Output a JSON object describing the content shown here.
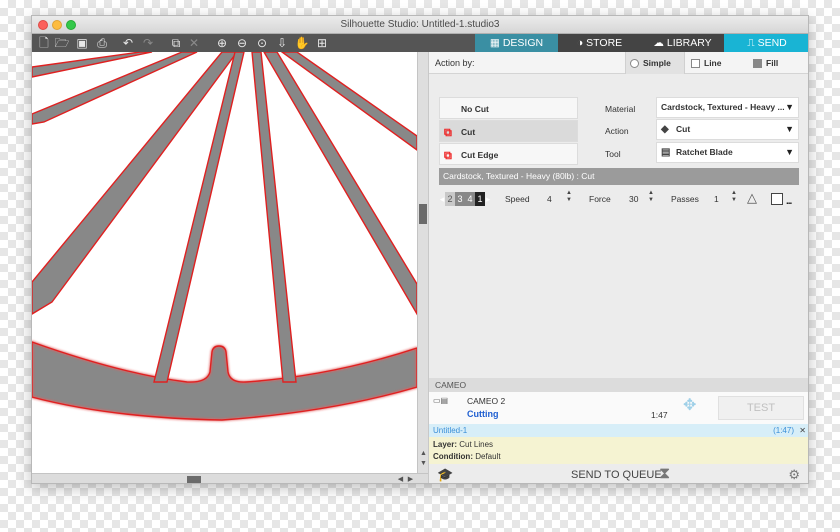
{
  "window": {
    "title": "Silhouette Studio: Untitled-1.studio3"
  },
  "toolbar": {
    "icons": [
      "new-icon",
      "open-icon",
      "save-icon",
      "print-icon",
      "undo-icon",
      "redo-icon",
      "group-icon",
      "ungroup-icon",
      "zoom-in-icon",
      "zoom-out-icon",
      "zoom-fit-icon",
      "pan-down-icon",
      "hand-icon",
      "add-page-icon"
    ]
  },
  "tabs": {
    "design": "DESIGN",
    "store": "STORE",
    "library": "LIBRARY",
    "send": "SEND"
  },
  "panel": {
    "action_by_label": "Action by:",
    "mode_simple": "Simple",
    "mode_line": "Line",
    "mode_fill": "Fill",
    "cut_options": [
      "No Cut",
      "Cut",
      "Cut Edge"
    ],
    "material_label": "Material",
    "material_value": "Cardstock, Textured - Heavy ...",
    "action_label": "Action",
    "action_value": "Cut",
    "tool_label": "Tool",
    "tool_value": "Ratchet Blade",
    "material_bar": "Cardstock, Textured - Heavy (80lb) : Cut",
    "sequence": [
      "2",
      "3",
      "4",
      "1"
    ],
    "speed_label": "Speed",
    "speed_value": "4",
    "force_label": "Force",
    "force_value": "30",
    "passes_label": "Passes",
    "passes_value": "1",
    "more": "..."
  },
  "device": {
    "section": "CAMEO",
    "name": "CAMEO 2",
    "status": "Cutting",
    "time": "1:47",
    "test_label": "TEST"
  },
  "job": {
    "name": "Untitled-1",
    "time": "(1:47)",
    "close": "✕",
    "layer_label": "Layer:",
    "layer_value": "Cut Lines",
    "condition_label": "Condition:",
    "condition_value": "Default"
  },
  "bottom": {
    "send_to_queue": "SEND TO QUEUE"
  },
  "colors": {
    "send_tab": "#19b4d4",
    "design_tab": "#3a8fa3",
    "cut_line": "#e02020",
    "shape_fill": "#888888",
    "status_blue": "#1f5fd1"
  }
}
